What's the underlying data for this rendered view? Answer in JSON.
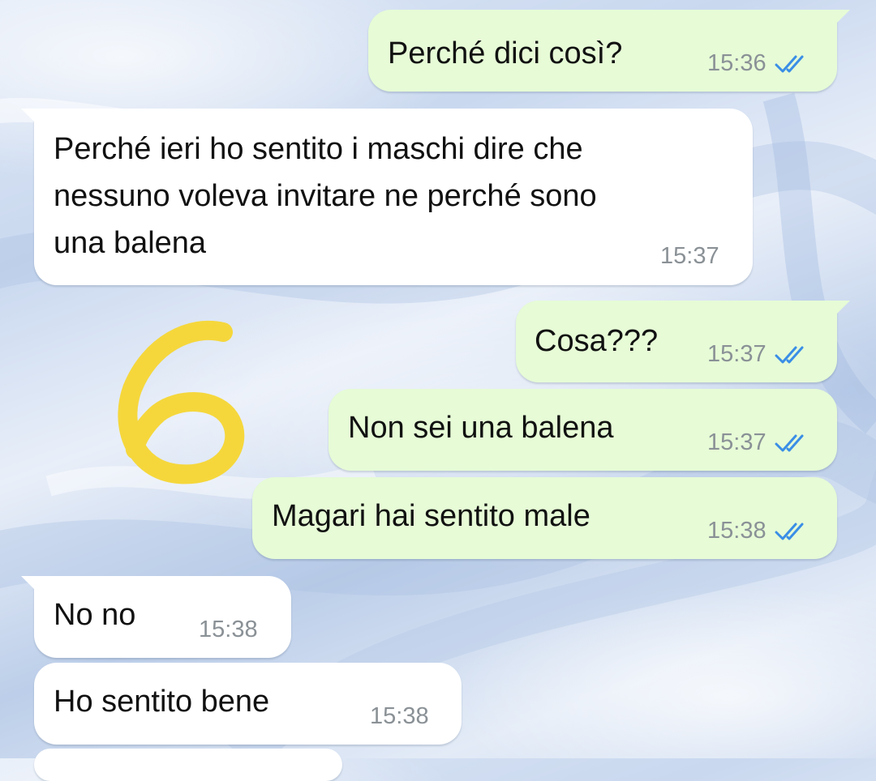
{
  "chat": {
    "messages": [
      {
        "direction": "out",
        "text": "Perché dici così?",
        "time": "15:36",
        "status": "read"
      },
      {
        "direction": "in",
        "text": "Perché ieri ho sentito i maschi dire che\nnessuno voleva invitare ne perché sono\nuna balena",
        "lines": [
          "Perché ieri ho sentito i maschi dire che",
          "nessuno voleva invitare ne perché sono",
          "una balena"
        ],
        "time": "15:37"
      },
      {
        "direction": "out",
        "text": "Cosa???",
        "time": "15:37",
        "status": "read"
      },
      {
        "direction": "out",
        "text": "Non sei una balena",
        "time": "15:37",
        "status": "read"
      },
      {
        "direction": "out",
        "text": "Magari hai sentito male",
        "time": "15:38",
        "status": "read"
      },
      {
        "direction": "in",
        "text": "No no",
        "time": "15:38"
      },
      {
        "direction": "in",
        "text": "Ho sentito bene",
        "time": "15:38"
      }
    ]
  },
  "overlay": {
    "marker_number": "6",
    "marker_color": "#f5d73c"
  },
  "colors": {
    "outgoing_bubble": "#e6fbd6",
    "incoming_bubble": "#ffffff",
    "read_ticks": "#3a8ee6",
    "timestamp": "#8a9196"
  },
  "icons": {
    "read_status": "double-check-icon"
  }
}
